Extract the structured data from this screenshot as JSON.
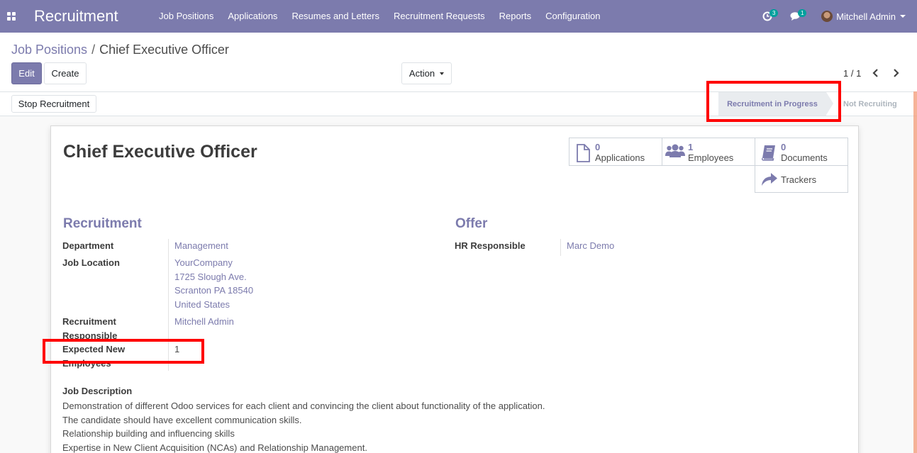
{
  "navbar": {
    "app_name": "Recruitment",
    "menu": [
      "Job Positions",
      "Applications",
      "Resumes and Letters",
      "Recruitment Requests",
      "Reports",
      "Configuration"
    ],
    "activity_count": "3",
    "message_count": "1",
    "user_name": "Mitchell Admin"
  },
  "breadcrumb": {
    "parent": "Job Positions",
    "separator": "/",
    "current": "Chief Executive Officer"
  },
  "buttons": {
    "edit": "Edit",
    "create": "Create",
    "action": "Action",
    "stop_recruitment": "Stop Recruitment"
  },
  "pager": {
    "value": "1 / 1"
  },
  "statusbar": {
    "stages": [
      "Recruitment in Progress",
      "Not Recruiting"
    ],
    "active_index": 0
  },
  "record": {
    "title": "Chief Executive Officer",
    "smart_buttons": [
      {
        "count": "0",
        "label": "Applications",
        "icon": "file-icon"
      },
      {
        "count": "1",
        "label": "Employees",
        "icon": "users-icon"
      },
      {
        "count": "0",
        "label": "Documents",
        "icon": "book-icon"
      },
      {
        "label": "Trackers",
        "icon": "share-icon"
      }
    ],
    "recruitment": {
      "title": "Recruitment",
      "department_label": "Department",
      "department": "Management",
      "job_location_label": "Job Location",
      "job_location_lines": [
        "YourCompany",
        "1725 Slough Ave.",
        "Scranton PA 18540",
        "United States"
      ],
      "recruitment_responsible_label_lines": [
        "Recruitment",
        "Responsible"
      ],
      "recruitment_responsible": "Mitchell Admin",
      "expected_new_employees_label_lines": [
        "Expected New",
        "Employees"
      ],
      "expected_new_employees": "1"
    },
    "offer": {
      "title": "Offer",
      "hr_responsible_label": "HR Responsible",
      "hr_responsible": "Marc Demo"
    },
    "job_description": {
      "label": "Job Description",
      "lines": [
        "Demonstration of different Odoo services for each client and convincing the client about functionality of the application.",
        "The candidate should have excellent communication skills.",
        "Relationship building and influencing skills",
        "Expertise in New Client Acquisition (NCAs) and Relationship Management."
      ]
    }
  },
  "colors": {
    "brand": "#7c7bad",
    "badge": "#00a09d",
    "highlight": "#ff0000"
  }
}
